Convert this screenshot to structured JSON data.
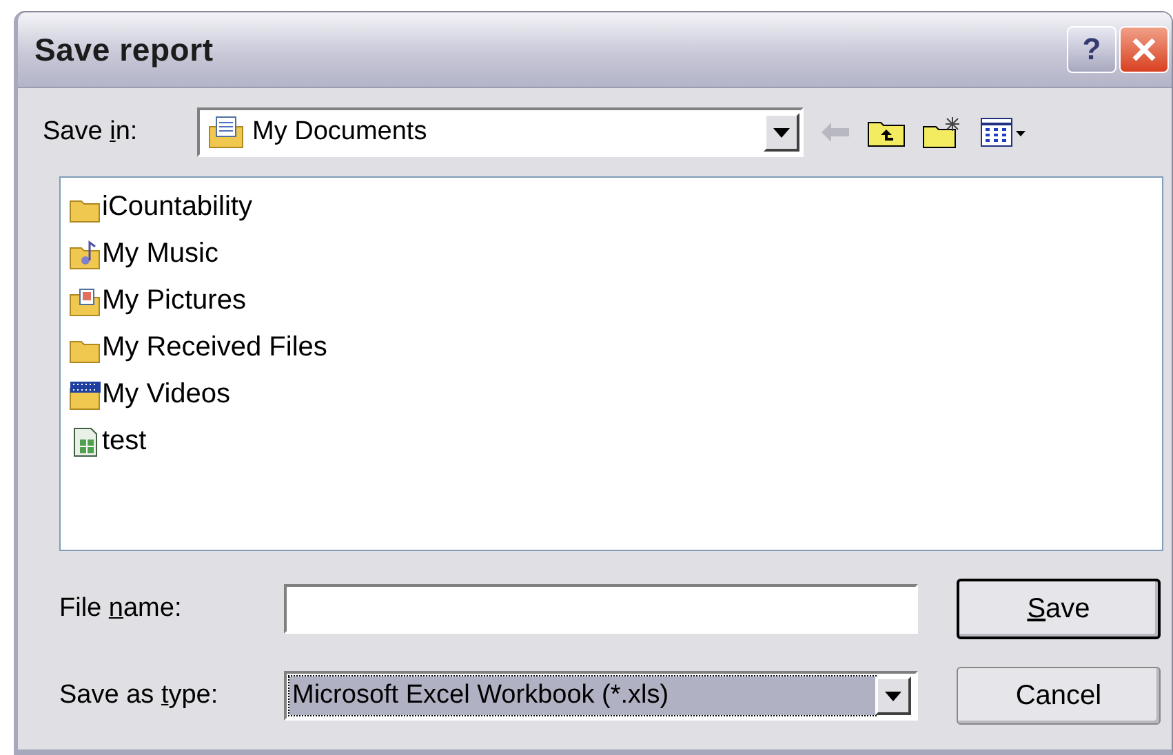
{
  "window": {
    "title": "Save report",
    "help": "?"
  },
  "save_in": {
    "label": {
      "before": "Save ",
      "key": "i",
      "after": "n:"
    },
    "value": "My Documents"
  },
  "files": [
    {
      "name": "iCountability",
      "kind": "folder"
    },
    {
      "name": "My Music",
      "kind": "music"
    },
    {
      "name": "My Pictures",
      "kind": "pictures"
    },
    {
      "name": "My Received Files",
      "kind": "folder"
    },
    {
      "name": "My Videos",
      "kind": "videos"
    },
    {
      "name": "test",
      "kind": "spreadsheet"
    }
  ],
  "file_name": {
    "label": {
      "before": "File ",
      "key": "n",
      "after": "ame:"
    }
  },
  "save_as_type": {
    "label": {
      "before": "Save as ",
      "key": "t",
      "after": "ype:"
    },
    "value": "Microsoft Excel Workbook (*.xls)"
  },
  "buttons": [
    {
      "label": {
        "key": "S",
        "after": "ave"
      },
      "default": true
    },
    {
      "label": {
        "before": "Cancel"
      },
      "default": false
    }
  ]
}
